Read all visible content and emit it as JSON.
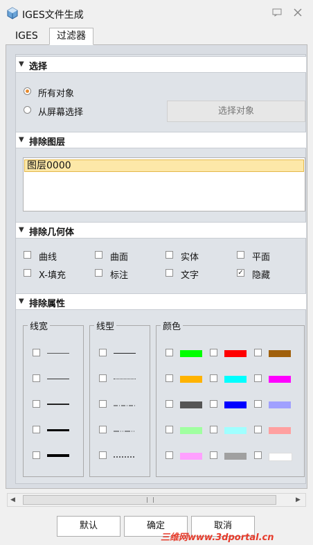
{
  "window": {
    "title": "IGES文件生成",
    "icon": "app-icon"
  },
  "tabs": [
    {
      "label": "IGES",
      "active": false
    },
    {
      "label": "过滤器",
      "active": true
    }
  ],
  "select_section": {
    "header": "选择",
    "options": [
      {
        "label": "所有对象",
        "selected": true
      },
      {
        "label": "从屏幕选择",
        "selected": false
      }
    ],
    "select_button": "选择对象"
  },
  "exclude_layers": {
    "header": "排除图层",
    "items": [
      "图层0000"
    ]
  },
  "exclude_geometry": {
    "header": "排除几何体",
    "items": [
      {
        "label": "曲线",
        "checked": false
      },
      {
        "label": "曲面",
        "checked": false
      },
      {
        "label": "实体",
        "checked": false
      },
      {
        "label": "平面",
        "checked": false
      },
      {
        "label": "X-填充",
        "checked": false
      },
      {
        "label": "标注",
        "checked": false
      },
      {
        "label": "文字",
        "checked": false
      },
      {
        "label": "隐藏",
        "checked": true
      }
    ]
  },
  "exclude_attributes": {
    "header": "排除属性",
    "line_width": {
      "title": "线宽",
      "items": [
        1,
        2,
        3,
        4,
        5
      ]
    },
    "line_type": {
      "title": "线型",
      "items": [
        "solid",
        "dotted",
        "dash-dot",
        "dash-dot-dot",
        "dashed"
      ]
    },
    "color": {
      "title": "颜色",
      "swatches": [
        [
          "#00ff00",
          "#ff0000",
          "#a0600c"
        ],
        [
          "#ffb300",
          "#00ffff",
          "#ff00ff"
        ],
        [
          "#555555",
          "#0000ff",
          "#a0a0ff"
        ],
        [
          "#a0ffa0",
          "#a0ffff",
          "#ffa0a0"
        ],
        [
          "#ffa0ff",
          "#a0a0a0",
          "#ffffff"
        ]
      ]
    }
  },
  "buttons": {
    "default": "默认",
    "ok": "确定",
    "cancel": "取消"
  },
  "watermark": "三维网www.3dportal.cn"
}
